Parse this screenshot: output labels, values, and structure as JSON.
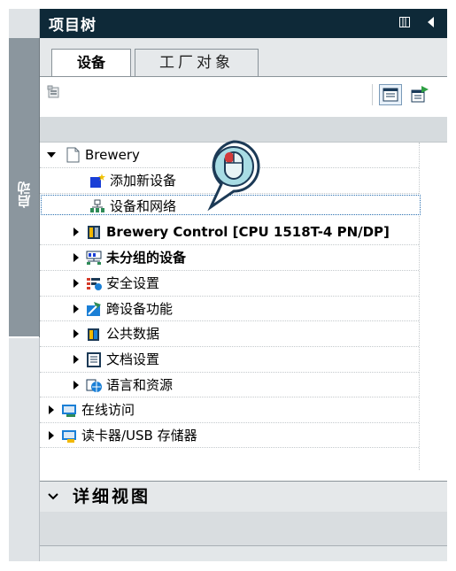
{
  "window": {
    "title": "项目树",
    "start_strip_label": "启动"
  },
  "tabs": [
    {
      "label": "设备",
      "active": true
    },
    {
      "label": "工厂对象",
      "active": false
    }
  ],
  "tree": {
    "items": [
      {
        "label": "Brewery",
        "level": 0,
        "expanded": true,
        "icon": "project-icon"
      },
      {
        "label": "添加新设备",
        "level": 1,
        "icon": "add-device-icon"
      },
      {
        "label": "设备和网络",
        "level": 1,
        "icon": "network-icon",
        "selected": true
      },
      {
        "label": "Brewery Control [CPU 1518T-4 PN/DP]",
        "level": 1,
        "expanded": false,
        "icon": "plc-icon",
        "bold": true
      },
      {
        "label": "未分组的设备",
        "level": 1,
        "expanded": false,
        "icon": "ungrouped-devices-icon",
        "bold": true
      },
      {
        "label": "安全设置",
        "level": 1,
        "expanded": false,
        "icon": "security-icon"
      },
      {
        "label": "跨设备功能",
        "level": 1,
        "expanded": false,
        "icon": "cross-device-icon"
      },
      {
        "label": "公共数据",
        "level": 1,
        "expanded": false,
        "icon": "common-data-icon"
      },
      {
        "label": "文档设置",
        "level": 1,
        "expanded": false,
        "icon": "document-settings-icon"
      },
      {
        "label": "语言和资源",
        "level": 1,
        "expanded": false,
        "icon": "language-icon"
      },
      {
        "label": "在线访问",
        "level": 0,
        "expanded": false,
        "icon": "online-access-icon"
      },
      {
        "label": "读卡器/USB 存储器",
        "level": 0,
        "expanded": false,
        "icon": "card-reader-icon"
      }
    ]
  },
  "detail_view": {
    "title": "详细视图"
  },
  "colors": {
    "titlebar": "#0e2938",
    "strip": "#8b969e",
    "selection_border": "#2a6fb0"
  }
}
